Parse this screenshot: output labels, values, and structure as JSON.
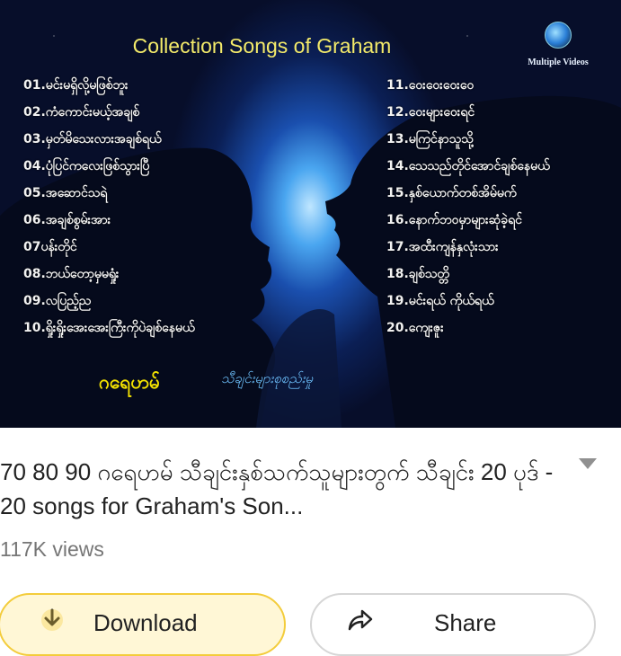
{
  "thumbnail": {
    "title": "Collection Songs of  Graham",
    "badge_label": "Multiple Videos",
    "songs_left": [
      "01.မင်းမရှိလို့မဖြစ်ဘူး",
      "02.ကံကောင်းမယ့်အချစ်",
      "03.မှတ်မိသေးလားအချစ်ရယ်",
      "04.ပုံပြင်ကလေးဖြစ်သွားပြီ",
      "05.အဆောင်သရဲ",
      "06.အချစ်စွမ်းအား",
      "07ပန်းတိုင်",
      "08.ဘယ်တော့မှမရှုံး",
      "09.လပြည့်ည",
      "10.ရှိုးရှိုးအေးအေးကြီးကိုပဲချစ်နေမယ်"
    ],
    "songs_right": [
      "11.ဝေးဝေးဝေးဝေ",
      "12.ဝေးများဝေးရင်",
      "13.မကြင်နာသူသို့",
      "14.သေသည်တိုင်အောင်ချစ်နေမယ်",
      "15.နှစ်ယောက်တစ်အိမ်မက်",
      "16.နောက်ဘဝမှာများဆုံခဲ့ရင်",
      "17.အထီးကျန်နှလုံးသား",
      "18.ချစ်သတ္တိ",
      "19.မင်းရယ် ကိုယ်ရယ်",
      "20.ကျေးဇူး"
    ],
    "artist": "ဂရေဟမ်",
    "subtitle": "သီချင်းများစုစည်းမှု"
  },
  "video": {
    "title": "70 80 90 ဂရေဟမ် သီချင်းနှစ်သက်သူများတွက် သီချင်း 20 ပုဒ် - 20 songs for Graham's Son...",
    "views": "117K views"
  },
  "actions": {
    "download_label": "Download",
    "share_label": "Share"
  },
  "colors": {
    "title_yellow": "#f3ea6a",
    "download_bg": "#fff7d6",
    "download_border": "#f3cc3b"
  },
  "icons": {
    "expand": "chevron-down-icon",
    "download": "download-icon",
    "share": "share-icon"
  }
}
